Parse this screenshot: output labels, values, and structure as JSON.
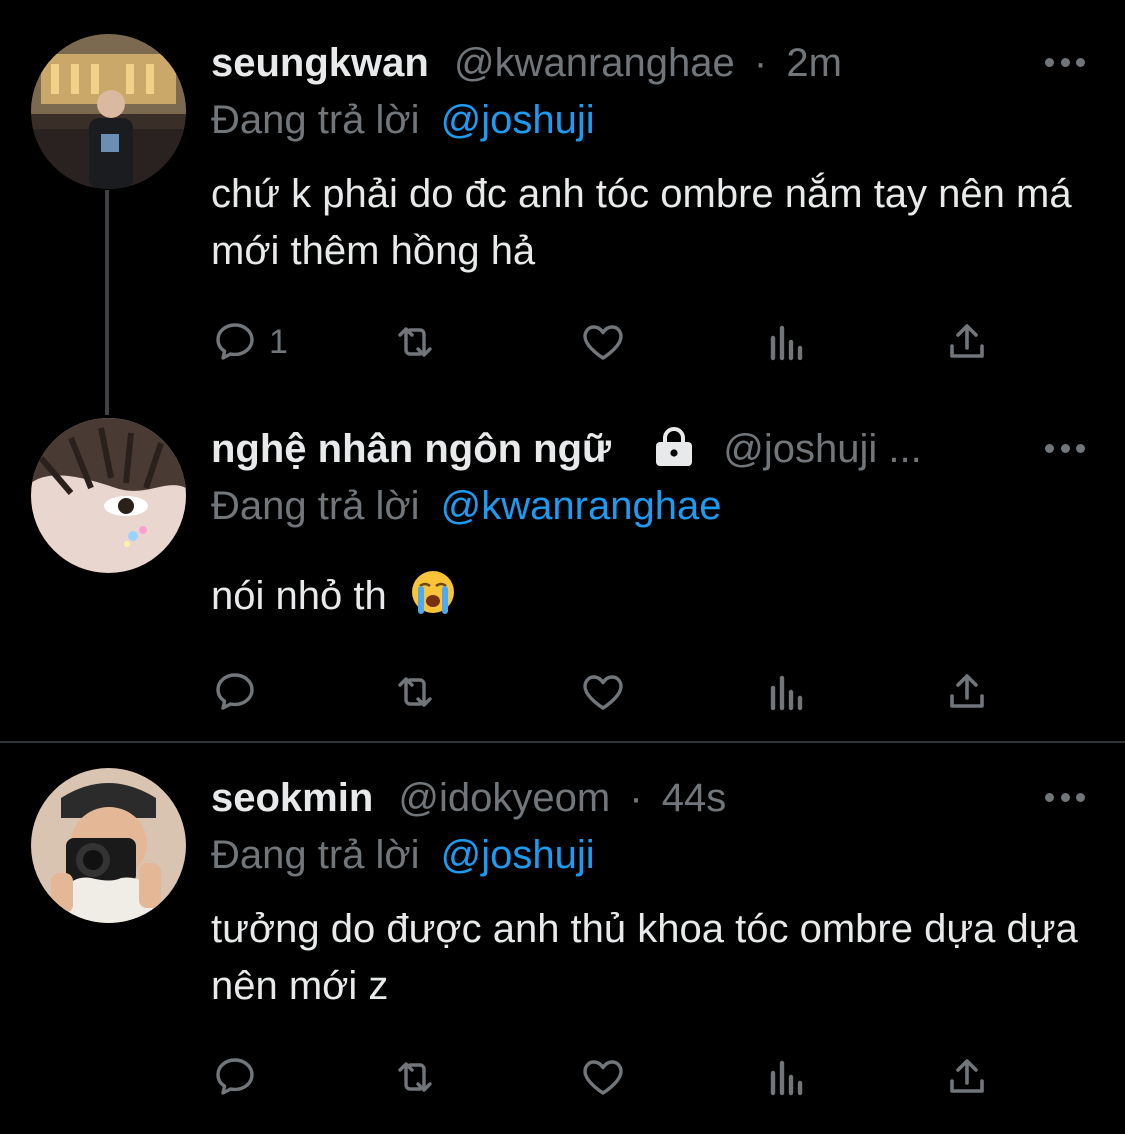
{
  "tweets": [
    {
      "name": "seungkwan",
      "handle": "@kwanranghae",
      "dot": "·",
      "time": "2m",
      "reply_prefix": "Đang trả lời",
      "reply_to": "@joshuji",
      "text": "chứ k phải do đc anh tóc ombre nắm tay nên má mới thêm hồng hả",
      "reply_count": "1"
    },
    {
      "name": "nghệ nhân ngôn ngữ",
      "handle": "@joshuji ...",
      "reply_prefix": "Đang trả lời",
      "reply_to": "@kwanranghae",
      "text": "nói nhỏ th",
      "emoji": "loudly-crying-face"
    },
    {
      "name": "seokmin",
      "handle": "@idokyeom",
      "dot": "·",
      "time": "44s",
      "reply_prefix": "Đang trả lời",
      "reply_to": "@joshuji",
      "text": "tưởng do được anh thủ khoa tóc ombre dựa dựa nên mới z"
    }
  ],
  "icons": {
    "reply": "reply-icon",
    "retweet": "retweet-icon",
    "like": "like-icon",
    "views": "views-icon",
    "share": "share-icon",
    "more": "more-icon",
    "lock": "lock-icon"
  },
  "colors": {
    "background": "#000000",
    "text": "#e7e9ea",
    "secondary": "#71767b",
    "accent": "#1d9bf0"
  }
}
